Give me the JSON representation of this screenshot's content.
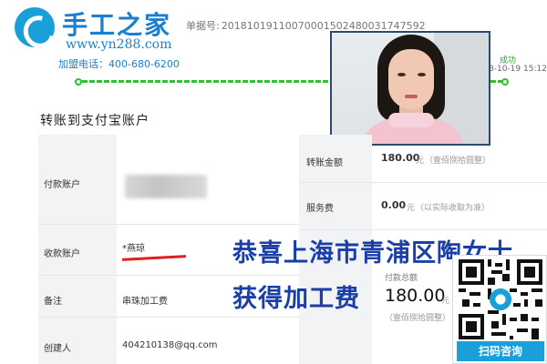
{
  "brand": {
    "name": "手工之家",
    "url": "www.yn288.com",
    "phone": "加盟电话：400-680-6200",
    "accent_color": "#1a7fcf"
  },
  "order": {
    "label": "单据号:",
    "number": "20181019110070001502480031747592"
  },
  "progress": {
    "status": "成功",
    "time": "8-10-19 15:12",
    "color": "#30c030"
  },
  "panel": {
    "title": "转账到支付宝账户",
    "rows": {
      "payer_label": "付款账户",
      "payee_label": "收款账户",
      "payee_name": "*燕琼",
      "note_label": "备注",
      "note_value": "串珠加工费",
      "creator_label": "创建人",
      "creator_value": "404210138@qq.com"
    },
    "amounts": {
      "transfer_label": "转账金额",
      "transfer_value": "180.00",
      "transfer_unit": "元",
      "transfer_words": "（壹佰捌拾圆整）",
      "fee_label": "服务费",
      "fee_value": "0.00",
      "fee_unit": "元",
      "fee_note": "（以实际收取为准）",
      "total_label": "付款总额",
      "total_value": "180.00",
      "total_unit": "元",
      "total_words": "（壹佰捌拾圆整）"
    }
  },
  "overlay": {
    "line1": "恭喜上海市青浦区陶女士",
    "line2": "获得加工费",
    "color": "#1b3fa8"
  },
  "qr": {
    "label": "扫码咨询"
  }
}
